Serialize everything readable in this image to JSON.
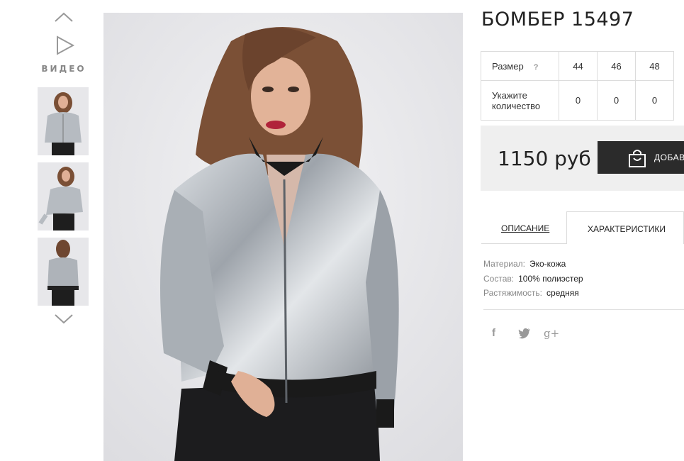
{
  "thumbnails": {
    "video_label": "ВИДЕО",
    "icons": [
      "chevron-up-icon",
      "play-icon",
      "chevron-down-icon"
    ]
  },
  "product": {
    "title": "БОМБЕР 15497"
  },
  "size_table": {
    "size_label": "Размер",
    "help_symbol": "?",
    "sizes": [
      "44",
      "46",
      "48"
    ],
    "quantity_label": "Укажите количество",
    "quantities": [
      "0",
      "0",
      "0"
    ]
  },
  "purchase": {
    "price": "1150 руб",
    "add_button_label": "ДОБАВ"
  },
  "tabs": {
    "description": "ОПИСАНИЕ",
    "characteristics": "ХАРАКТЕРИСТИКИ"
  },
  "specs": [
    {
      "label": "Материал:",
      "value": "Эко-кожа"
    },
    {
      "label": "Состав:",
      "value": "100% полиэстер"
    },
    {
      "label": "Растяжимость:",
      "value": "средняя"
    }
  ],
  "social": {
    "facebook_glyph": "f",
    "googleplus_glyph": "g+"
  },
  "colors": {
    "button_dark": "#2b2b2b",
    "price_bg": "#efefef",
    "jacket_silver": "#b4b9bf"
  }
}
